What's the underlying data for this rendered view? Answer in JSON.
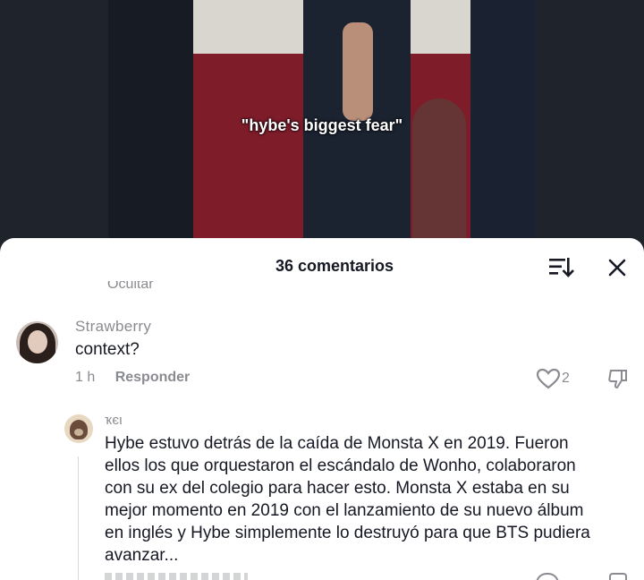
{
  "video": {
    "caption": "\"hybe's biggest fear\""
  },
  "comments_panel": {
    "title": "36 comentarios",
    "hidden_fragment": "Ocultar",
    "icons": {
      "sort": "sort-descending-icon",
      "close": "close-icon"
    }
  },
  "comments": [
    {
      "username": "Strawberry",
      "text": "context?",
      "time": "1 h",
      "reply_label": "Responder",
      "likes": "2"
    },
    {
      "username": "ҡєι",
      "text_lines": [
        "Hybe estuvo detrás de la caída de Monsta X en 2019. Fueron",
        "ellos los que orquestaron el escándalo de Wonho, colaboraron",
        "con su ex del colegio para hacer esto. Monsta X estaba en su",
        "mejor momento en 2019 con el lanzamiento de su nuevo álbum",
        "en inglés y Hybe simplemente lo destruyó para que BTS pudiera",
        "avanzar..."
      ]
    }
  ],
  "colors": {
    "text": "#161823",
    "muted": "#8a8b91",
    "sheet_bg": "#ffffff",
    "page_bg": "#1e222b"
  }
}
